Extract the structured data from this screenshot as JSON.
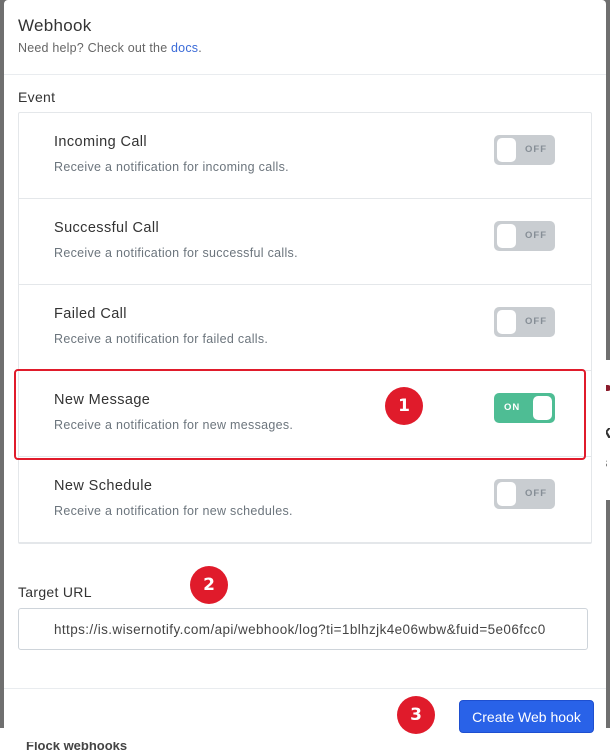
{
  "modal": {
    "title": "Webhook",
    "help_text": "Need help? Check out the",
    "help_link": "docs",
    "help_suffix": "."
  },
  "events": {
    "label": "Event",
    "items": [
      {
        "name": "Incoming Call",
        "description": "Receive a notification for incoming calls.",
        "state": "OFF"
      },
      {
        "name": "Successful Call",
        "description": "Receive a notification for successful calls.",
        "state": "OFF"
      },
      {
        "name": "Failed Call",
        "description": "Receive a notification for failed calls.",
        "state": "OFF"
      },
      {
        "name": "New Message",
        "description": "Receive a notification for new messages.",
        "state": "ON"
      },
      {
        "name": "New Schedule",
        "description": "Receive a notification for new schedules.",
        "state": "OFF"
      }
    ]
  },
  "target": {
    "label": "Target URL",
    "value": "https://is.wisernotify.com/api/webhook/log?ti=1blhzjk4e06wbw&fuid=5e06fcc0"
  },
  "footer": {
    "create_label": "Create Web hook"
  },
  "annotations": {
    "badge_1": "1",
    "badge_2": "2",
    "badge_3": "3"
  },
  "background": {
    "fragment_k": "k",
    "fragment_s": "s",
    "fragment_f": "f",
    "fragment_flock": "Flock webhooks"
  },
  "colors": {
    "toggle_on": "#4ebd94",
    "toggle_off": "#c9cdd1",
    "primary_button": "#2962e8",
    "annotation_red": "#e01b2b",
    "link": "#3b6bd8"
  }
}
